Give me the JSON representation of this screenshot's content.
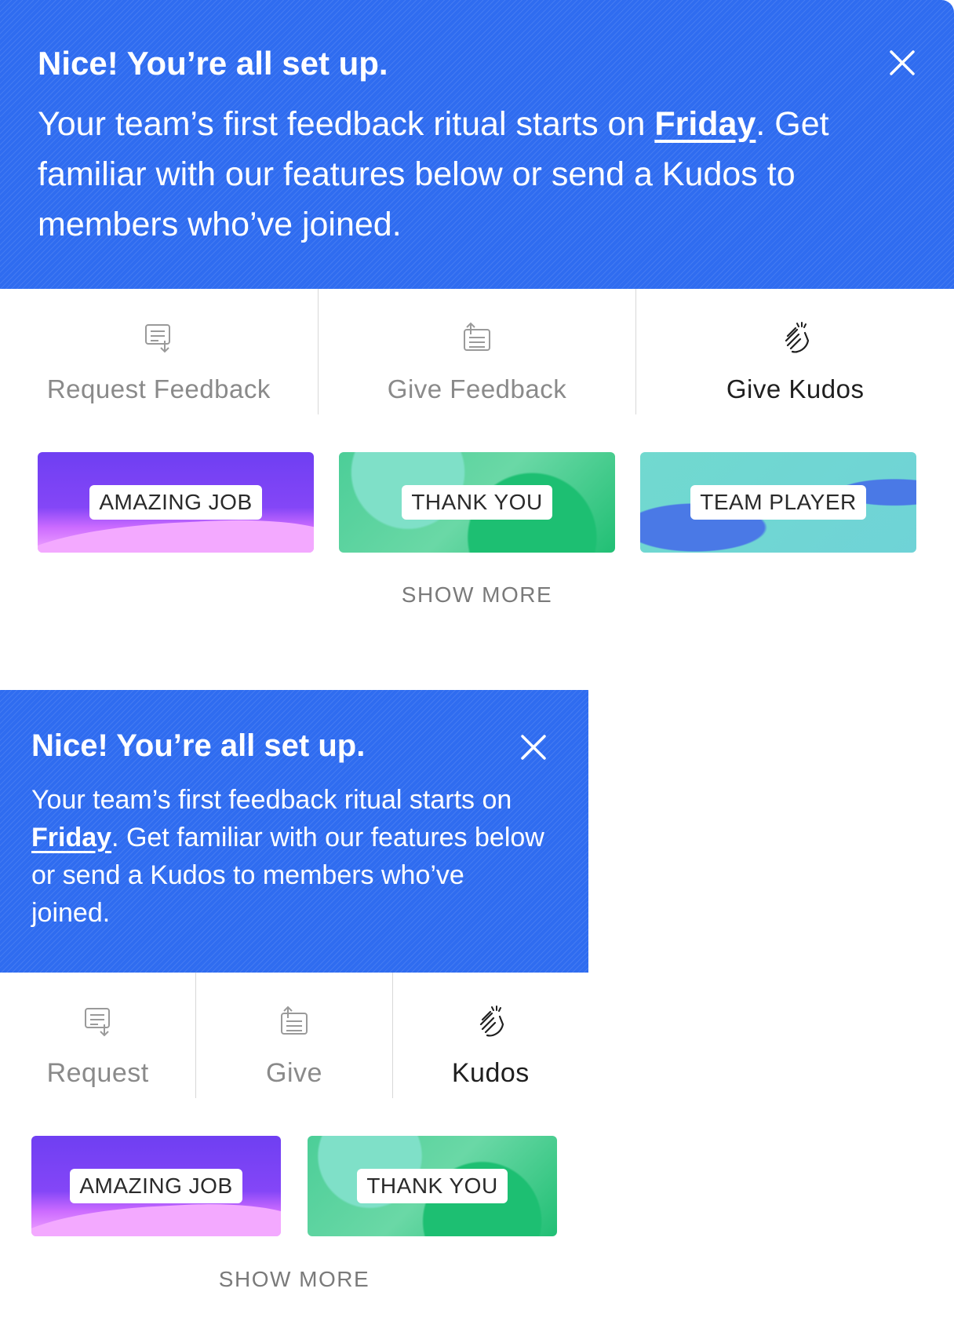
{
  "large": {
    "banner": {
      "title": "Nice! You’re all set up.",
      "body_prefix": "Your team’s first feedback ritual starts on ",
      "link": "Friday",
      "body_suffix": ". Get familiar with our features below or send a Kudos to members who’ve joined."
    },
    "tabs": [
      {
        "label": "Request Feedback",
        "icon": "request-feedback-icon",
        "active": false
      },
      {
        "label": "Give Feedback",
        "icon": "give-feedback-icon",
        "active": false
      },
      {
        "label": "Give Kudos",
        "icon": "clap-icon",
        "active": true
      }
    ],
    "cards": [
      "AMAZING JOB",
      "THANK YOU",
      "TEAM PLAYER"
    ],
    "show_more": "SHOW MORE"
  },
  "small": {
    "banner": {
      "title": "Nice! You’re all set up.",
      "body_prefix": "Your team’s first feedback ritual starts on ",
      "link": "Friday",
      "body_suffix": ". Get familiar with our features below or send a Kudos to members who’ve joined."
    },
    "tabs": [
      {
        "label": "Request",
        "icon": "request-feedback-icon",
        "active": false
      },
      {
        "label": "Give",
        "icon": "give-feedback-icon",
        "active": false
      },
      {
        "label": "Kudos",
        "icon": "clap-icon",
        "active": true
      }
    ],
    "cards": [
      "AMAZING JOB",
      "THANK YOU"
    ],
    "show_more": "SHOW MORE"
  },
  "colors": {
    "banner_blue": "#2f6cf0",
    "inactive_text": "#8a8a8a",
    "active_text": "#1f1f1f"
  }
}
